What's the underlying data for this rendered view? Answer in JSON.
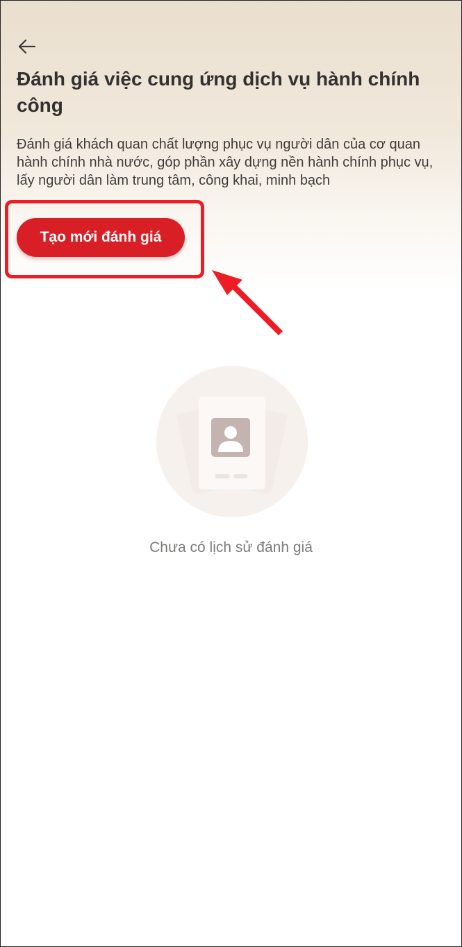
{
  "header": {
    "back_icon": "arrow-left-icon",
    "title": "Đánh giá việc cung ứng dịch vụ hành chính công",
    "description": "Đánh giá khách quan chất lượng phục vụ người dân của cơ quan hành chính nhà nước, góp phần xây dựng nền hành chính phục vụ, lấy người dân làm trung tâm, công khai, minh bạch"
  },
  "actions": {
    "create_label": "Tạo mới đánh giá"
  },
  "empty_state": {
    "icon": "user-card-icon",
    "message": "Chưa có lịch sử đánh giá"
  },
  "annotation": {
    "highlight_color": "#ee1c25"
  },
  "colors": {
    "accent": "#d81f26",
    "title": "#33312f",
    "muted": "#7d7b79"
  }
}
